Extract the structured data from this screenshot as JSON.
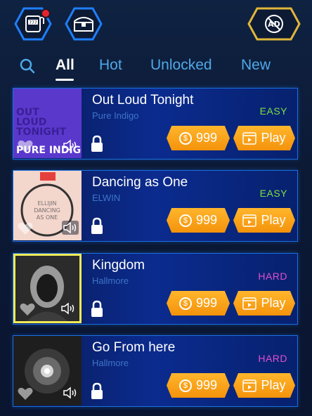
{
  "top_bar": {
    "slot_icon": "slot-machine-icon",
    "chest_icon": "treasure-chest-icon",
    "ad_label": "AD"
  },
  "tabs": [
    {
      "label": "All",
      "active": true
    },
    {
      "label": "Hot",
      "active": false
    },
    {
      "label": "Unlocked",
      "active": false
    },
    {
      "label": "New",
      "active": false
    }
  ],
  "songs": [
    {
      "title": "Out Loud Tonight",
      "artist": "Pure Indigo",
      "difficulty": "EASY",
      "price": "999",
      "play_label": "Play",
      "cover_text": "PURE INDIGO",
      "cover_lines": [
        "OUT",
        "LOUD",
        "TONIGHT"
      ]
    },
    {
      "title": "Dancing as One",
      "artist": "ELWIN",
      "difficulty": "EASY",
      "price": "999",
      "play_label": "Play",
      "cover_lines": [
        "ELLIJIN",
        "DANCING",
        "AS ONE"
      ]
    },
    {
      "title": "Kingdom",
      "artist": "Hallmore",
      "difficulty": "HARD",
      "price": "999",
      "play_label": "Play"
    },
    {
      "title": "Go From here",
      "artist": "Hallmore",
      "difficulty": "HARD",
      "price": "999",
      "play_label": "Play"
    }
  ],
  "colors": {
    "accent_blue": "#4fa8e8",
    "button_orange": "#f4930b",
    "easy": "#7ee042",
    "hard": "#e04fd0",
    "selected_border": "#f2ea57"
  }
}
